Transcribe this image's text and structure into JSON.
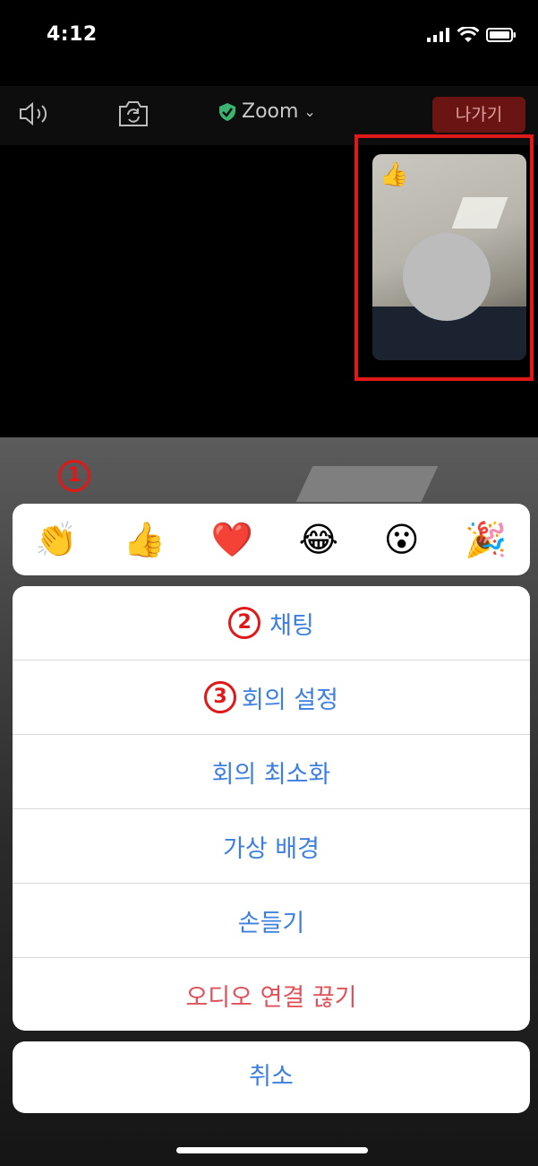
{
  "status_bar": {
    "time": "4:12",
    "icons": [
      "signal-icon",
      "wifi-icon",
      "battery-icon"
    ]
  },
  "toolbar": {
    "speaker_icon": "speaker-icon",
    "camera_flip_icon": "camera-switch-icon",
    "title": "Zoom",
    "shield_icon": "shield-check-icon",
    "leave_label": "나가기"
  },
  "video_thumbnail": {
    "reaction_emoji": "👍",
    "highlight_color": "#e01818"
  },
  "annotations": {
    "n1": "1",
    "n2": "2",
    "n3": "3"
  },
  "reactions": [
    "👏",
    "👍",
    "❤️",
    "😂",
    "😮",
    "🎉"
  ],
  "action_sheet": {
    "items": [
      {
        "label": "채팅"
      },
      {
        "label": "회의 설정"
      },
      {
        "label": "회의 최소화"
      },
      {
        "label": "가상 배경"
      },
      {
        "label": "손들기"
      },
      {
        "label": "오디오 연결 끊기"
      }
    ],
    "cancel_label": "취소"
  },
  "colors": {
    "accent": "#3d7fe0",
    "danger": "#e0525a",
    "leave_bg": "#6a1414",
    "annotation": "#e01818"
  }
}
